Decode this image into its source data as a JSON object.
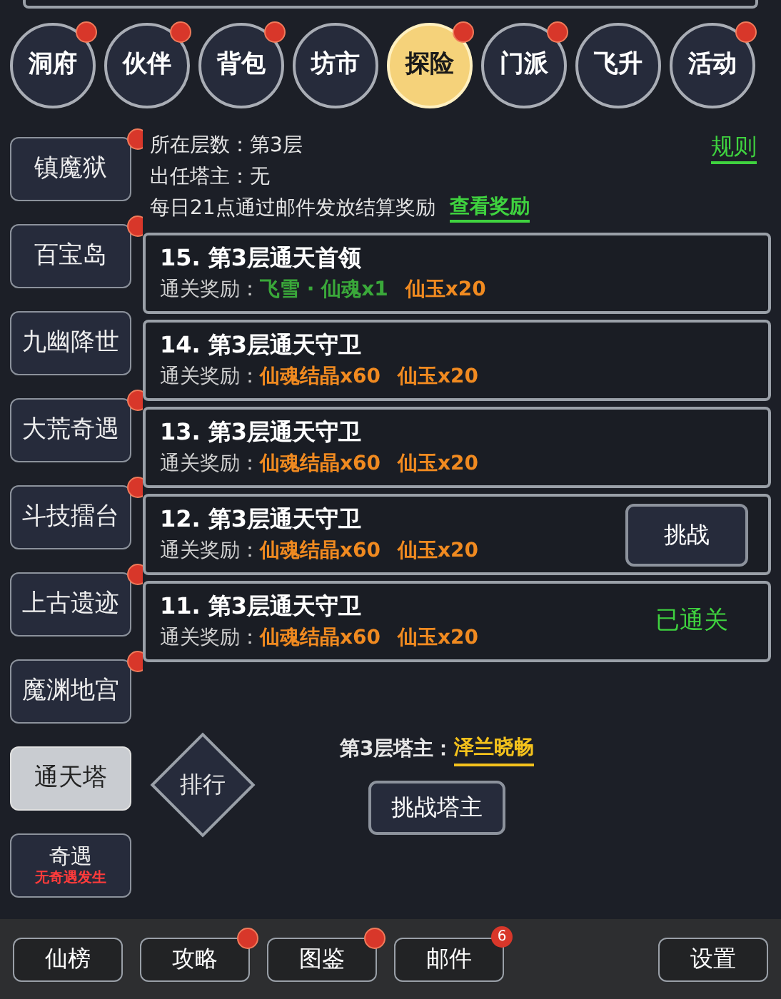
{
  "nav_tabs": [
    {
      "label": "洞府",
      "selected": false,
      "badge": true
    },
    {
      "label": "伙伴",
      "selected": false,
      "badge": true
    },
    {
      "label": "背包",
      "selected": false,
      "badge": true
    },
    {
      "label": "坊市",
      "selected": false,
      "badge": false
    },
    {
      "label": "探险",
      "selected": true,
      "badge": true
    },
    {
      "label": "门派",
      "selected": false,
      "badge": true
    },
    {
      "label": "飞升",
      "selected": false,
      "badge": false
    },
    {
      "label": "活动",
      "selected": false,
      "badge": true
    }
  ],
  "sidebar": [
    {
      "label": "镇魔狱",
      "selected": false,
      "badge": true
    },
    {
      "label": "百宝岛",
      "selected": false,
      "badge": true
    },
    {
      "label": "九幽降世",
      "selected": false,
      "badge": false
    },
    {
      "label": "大荒奇遇",
      "selected": false,
      "badge": true
    },
    {
      "label": "斗技擂台",
      "selected": false,
      "badge": true
    },
    {
      "label": "上古遗迹",
      "selected": false,
      "badge": true
    },
    {
      "label": "魔渊地宫",
      "selected": false,
      "badge": true
    },
    {
      "label": "通天塔",
      "selected": true,
      "badge": false
    },
    {
      "label": "奇遇",
      "selected": false,
      "badge": false,
      "subtitle": "无奇遇发生"
    }
  ],
  "info": {
    "floor": "所在层数：第3层",
    "master": "出任塔主：无",
    "notice": "每日21点通过邮件发放结算奖励",
    "view_rewards": "查看奖励",
    "rules": "规则"
  },
  "levels": [
    {
      "title": "15. 第3层通天首领",
      "reward_label": "通关奖励：",
      "rewards": [
        {
          "text": "飞雪 · 仙魂x1",
          "kind": "rare"
        },
        {
          "text": "仙玉x20",
          "kind": "normal"
        }
      ]
    },
    {
      "title": "14. 第3层通天守卫",
      "reward_label": "通关奖励：",
      "rewards": [
        {
          "text": "仙魂结晶x60",
          "kind": "normal"
        },
        {
          "text": "仙玉x20",
          "kind": "normal"
        }
      ]
    },
    {
      "title": "13. 第3层通天守卫",
      "reward_label": "通关奖励：",
      "rewards": [
        {
          "text": "仙魂结晶x60",
          "kind": "normal"
        },
        {
          "text": "仙玉x20",
          "kind": "normal"
        }
      ]
    },
    {
      "title": "12. 第3层通天守卫",
      "reward_label": "通关奖励：",
      "rewards": [
        {
          "text": "仙魂结晶x60",
          "kind": "normal"
        },
        {
          "text": "仙玉x20",
          "kind": "normal"
        }
      ],
      "action": {
        "kind": "button",
        "label": "挑战"
      }
    },
    {
      "title": "11. 第3层通天守卫",
      "reward_label": "通关奖励：",
      "rewards": [
        {
          "text": "仙魂结晶x60",
          "kind": "normal"
        },
        {
          "text": "仙玉x20",
          "kind": "normal"
        }
      ],
      "action": {
        "kind": "cleared",
        "label": "已通关"
      }
    }
  ],
  "tower_master": {
    "label": "第3层塔主：",
    "name": "泽兰晓畅",
    "ranking": "排行",
    "challenge": "挑战塔主"
  },
  "bottom_bar": [
    {
      "label": "仙榜",
      "badge": false
    },
    {
      "label": "攻略",
      "badge": true
    },
    {
      "label": "图鉴",
      "badge": true
    },
    {
      "label": "邮件",
      "count": "6"
    },
    {
      "label": "设置",
      "badge": false
    }
  ]
}
